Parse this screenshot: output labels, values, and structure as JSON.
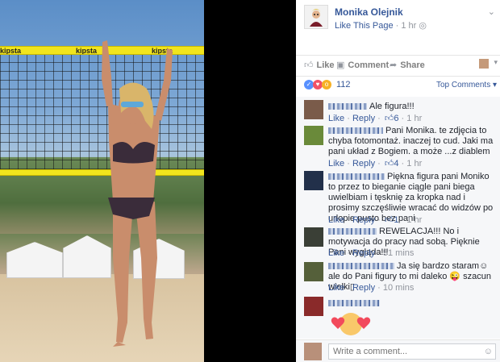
{
  "page": {
    "name": "Monika Olejnik",
    "like_label": "Like This Page",
    "time": "1 hr",
    "globe": "◎"
  },
  "photo": {
    "tape_brand": "kipsta"
  },
  "actions": {
    "like": "Like",
    "comment": "Comment",
    "share": "Share"
  },
  "reactions": {
    "count": "112",
    "sort_label": "Top Comments ▾",
    "types": [
      "like",
      "love",
      "wow"
    ]
  },
  "comments": [
    {
      "text": "Ale figura!!!",
      "like": "Like",
      "reply": "Reply",
      "likes": "6",
      "time": "1 hr"
    },
    {
      "text": "Pani Monika. te zdjęcia to chyba fotomontaż. inaczej to cud. Jaki ma pani układ z Bogiem. a może ...z diablem",
      "like": "Like",
      "reply": "Reply",
      "likes": "4",
      "time": "1 hr"
    },
    {
      "text": "Piękna figura pani Moniko to przez to bieganie ciągle pani biega uwielbiam i tęsknię za kropka nad i prosimy szczęśliwie wracać do widzów po urlopie pusto bez pani",
      "like": "Like",
      "reply": "Reply",
      "likes": "1",
      "time": "1 hr"
    },
    {
      "text": "REWELACJA!!! No i motywacja do pracy nad sobą. Pięknie Pani wygląda!!!",
      "like": "Like",
      "reply": "Reply",
      "likes": "",
      "time": "51 mins"
    },
    {
      "text": "Ja się bardzo staram☺ ale do Pani figury to mi daleko 😜 szacun wielki▯",
      "like": "Like",
      "reply": "Reply",
      "likes": "",
      "time": "10 mins"
    }
  ],
  "write": {
    "placeholder": "Write a comment..."
  },
  "colors": {
    "link": "#365899",
    "meta": "#90949c",
    "like_blue": "#5890ff",
    "love_red": "#f25268",
    "wow_yellow": "#f7b125"
  }
}
